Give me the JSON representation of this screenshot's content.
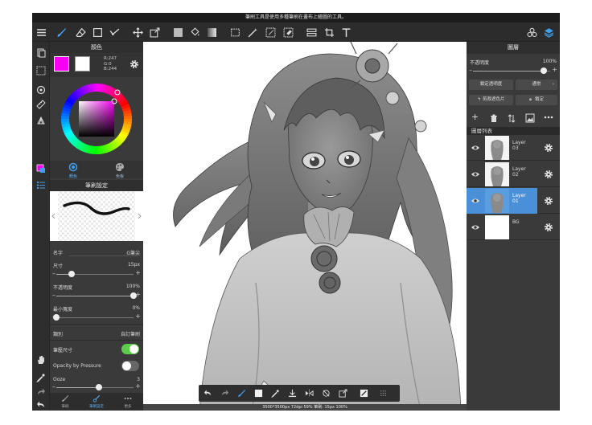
{
  "infobar": {
    "text": "筆刷工具是使用多種筆刷在畫布上繪圖的工具。"
  },
  "toolbar": {
    "icons": [
      "menu-icon",
      "brush-icon",
      "eraser-icon",
      "rectangle-icon",
      "vector-brush-icon",
      "move-icon",
      "transform-icon",
      "fill-color-icon",
      "bucket-icon",
      "gradient-icon",
      "select-icon",
      "magic-wand-icon",
      "select-pen-icon",
      "select-eraser-icon",
      "snap-icon",
      "crop-icon",
      "text-icon",
      "material-icon",
      "layers-icon"
    ]
  },
  "color_panel": {
    "title": "顏色",
    "main_color": "#f700f4",
    "sub_color": "#ffffff",
    "r": "R:247",
    "g": "G:0",
    "b": "B:244",
    "tab_color": "顏色",
    "tab_palette": "色板"
  },
  "brush_panel": {
    "title": "筆刷設定",
    "name_label": "名字",
    "name_value": "G筆尖",
    "size_label": "尺寸",
    "size_value": "15px",
    "size_fraction": 0.2,
    "opacity_label": "不透明度",
    "opacity_value": "100%",
    "opacity_fraction": 1.0,
    "minwidth_label": "最小寬度",
    "minwidth_value": "0%",
    "minwidth_fraction": 0.0,
    "type_label": "類別",
    "type_value": "自訂筆刷",
    "pressure_size_label": "筆壓尺寸",
    "pressure_size_on": true,
    "opacity_pressure_label": "Opacity by Pressure",
    "opacity_pressure_on": false,
    "ooze_label": "Ooze",
    "ooze_value": "3",
    "ooze_fraction": 0.55
  },
  "left_bottom": {
    "brush": "筆刷",
    "brush_settings": "筆刷設定",
    "more": "更多"
  },
  "layers_panel": {
    "title": "圖層",
    "opacity_label": "不透明度",
    "opacity_value": "100%",
    "lock_alpha": "鎖定透明度",
    "blend_mode": "通常",
    "clipping": "剪裁遮色片",
    "lock": "鎖定",
    "list_title": "圖層列表",
    "layers": [
      {
        "name_line1": "Layer",
        "name_line2": "03",
        "selected": false
      },
      {
        "name_line1": "Layer",
        "name_line2": "02",
        "selected": false
      },
      {
        "name_line1": "Layer",
        "name_line2": "01",
        "selected": true
      },
      {
        "name_line1": "BG",
        "name_line2": "",
        "selected": false
      }
    ]
  },
  "status": {
    "text": "3500*3500px 72dpi 59% 筆刷: 15px 100%"
  },
  "colors": {
    "accent": "#4a90d9",
    "toggle_on": "#5ccd4a",
    "panel_bg": "#3a3a3a",
    "toolbar_bg": "#2c2c2c"
  }
}
